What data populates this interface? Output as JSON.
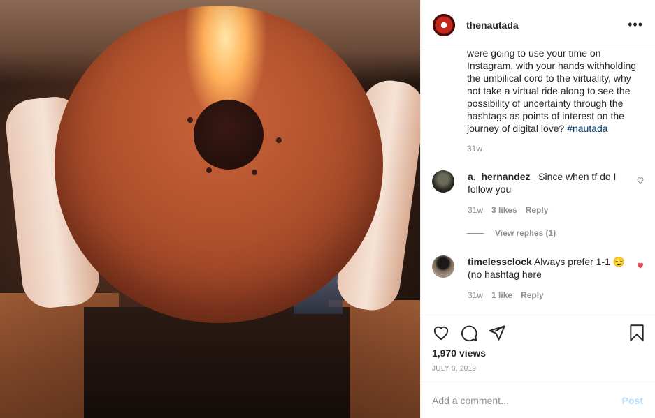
{
  "post": {
    "username": "thenautada",
    "more_label": "•••"
  },
  "caption": {
    "text": "were going to use your time on Instagram, with your hands withholding the umbilical cord to the virtuality, why not take a virtual ride along to see the possibility of uncertainty through the hashtags as points of interest on the journey of digital love?",
    "hashtag": "#nautada",
    "time": "31w"
  },
  "comments": [
    {
      "username": "a._hernandez_",
      "text": "Since when tf do I follow you",
      "time": "31w",
      "likes": "3 likes",
      "reply": "Reply",
      "view_replies": "View replies (1)",
      "liked": false
    },
    {
      "username": "timelessclock",
      "text": "Always prefer 1-1 😏 (no hashtag here",
      "time": "31w",
      "likes": "1 like",
      "reply": "Reply",
      "liked": true
    }
  ],
  "stats": {
    "views": "1,970 views",
    "date": "JULY 8, 2019"
  },
  "composer": {
    "placeholder": "Add a comment...",
    "post_label": "Post"
  },
  "colors": {
    "hashtag": "#00376b",
    "liked_heart": "#ed4956",
    "post_disabled": "#b2dffc"
  },
  "icons": {
    "like": "heart-icon",
    "comment": "comment-icon",
    "share": "share-icon",
    "save": "bookmark-icon"
  }
}
